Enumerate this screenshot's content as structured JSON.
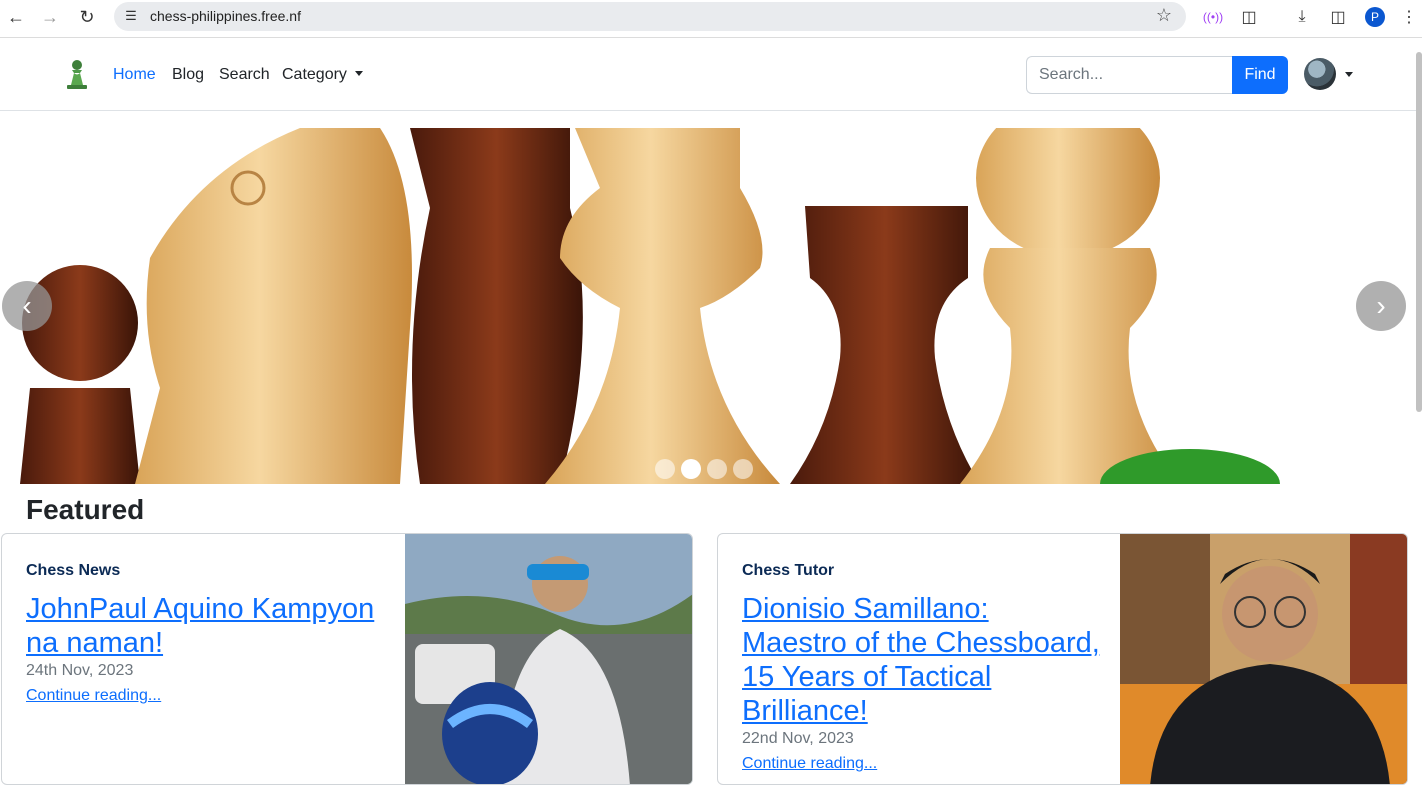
{
  "browser": {
    "url": "chess-philippines.free.nf",
    "profile_initial": "P"
  },
  "navbar": {
    "links": [
      "Home",
      "Blog",
      "Search",
      "Category"
    ],
    "search_placeholder": "Search...",
    "find_label": "Find"
  },
  "carousel": {
    "slide_count": 4,
    "active_index": 1
  },
  "featured": {
    "title": "Featured",
    "cards": [
      {
        "category": "Chess News",
        "title_line1": "JohnPaul Aquino Kampyon",
        "title_line2": "na naman!",
        "date": "24th Nov, 2023",
        "link": "Continue reading..."
      },
      {
        "category": "Chess Tutor",
        "title_line1": "Dionisio Samillano:",
        "title_line2": "Maestro of the Chessboard,",
        "title_line3": "15 Years of Tactical",
        "title_line4": "Brilliance!",
        "date": "22nd Nov, 2023",
        "link": "Continue reading..."
      }
    ]
  },
  "colors": {
    "primary": "#0d6efd",
    "category_text": "#0b2a55"
  }
}
